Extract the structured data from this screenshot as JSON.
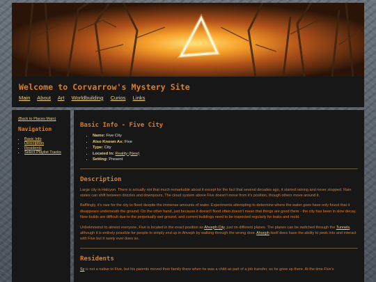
{
  "header": {
    "title": "Welcome to Corvarrow's Mystery Site",
    "nav": [
      "Main",
      "About",
      "Art",
      "Worldbuilding",
      "Curios",
      "Links"
    ]
  },
  "sidebar": {
    "back_link": "(Back to Places Main)",
    "heading": "Navigation",
    "items": [
      "Basic Info",
      "Description",
      "Residents",
      "Select Playlist Tracks"
    ]
  },
  "main": {
    "title": "Basic Info - Five City",
    "info": [
      {
        "label": "Name:",
        "value": "Five City"
      },
      {
        "label": "Also Known As:",
        "value": "Five"
      },
      {
        "label": "Type:",
        "value": "City"
      },
      {
        "label": "Located In:",
        "value": "Reality (New)"
      },
      {
        "label": "Setting:",
        "value": "Present"
      }
    ],
    "description": {
      "heading": "Description",
      "p1": "Large city in Halcyon. There is actually not that much remarkable about it except for the fact that several decades ago, it started raining and never stopped. Rain states can shift between drizzles and downpours. The cloud system above Five doesn't move from it's position, though others move around it.",
      "p2": "Bafflingly, it's rare for the city to flood despite the immense amounts of water. Experiments attempting to determine where the water goes have only found that it disappears underneath the ground. On the other hand, just because it doesn't flood often doesn't mean that things are good there - the city has been in slow decay. New builds are difficult due to the perpetually wet ground, and current buildings need to be inspected regularly for leaks and mold.",
      "p3_a": "Unbeknownst to almost everyone, Five is located in the exact position as ",
      "p3_link1": "Ahveph City",
      "p3_b": ", just on different planes. The planes can be switched through the ",
      "p3_link2": "Tunnels",
      "p3_c": ", although it is entirely possible for people to simply end up in Ahveph by walking through the wrong door. ",
      "p3_link3": "Ahveph",
      "p3_d": " itself does have the ability to peek into and interact with Five but it rarely ever does so."
    },
    "residents": {
      "heading": "Residents",
      "p1_link": "Sy",
      "p1_text": " is not a native to Five, but his parents moved their family there when he was a child as part of a job transfer, so he grew up there. At the time Five's"
    }
  },
  "colors": {
    "accent": "#e07d1e",
    "link": "#f0d070",
    "panel": "#171717"
  }
}
